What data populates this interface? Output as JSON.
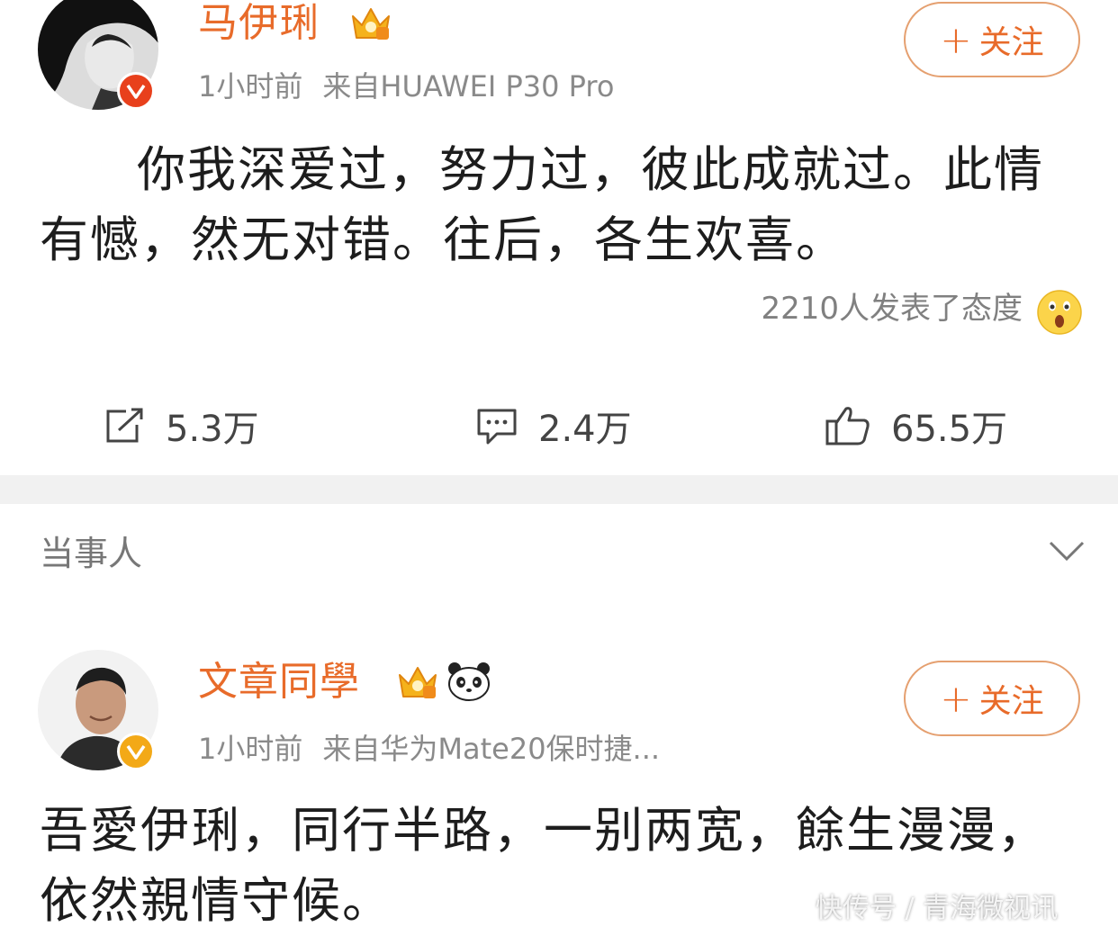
{
  "posts": [
    {
      "username": "马伊琍",
      "time": "1小时前",
      "source": "来自HUAWEI P30 Pro",
      "follow_label": "关注",
      "follow_plus": "+",
      "text": "你我深爱过，努力过，彼此成就过。此情有憾，然无对错。往后，各生欢喜。",
      "attitude": "2210人发表了态度",
      "actions": {
        "repost": "5.3万",
        "comment": "2.4万",
        "like": "65.5万"
      },
      "badge_color": "#e8401c"
    },
    {
      "username": "文章同學",
      "time": "1小时前",
      "source": "来自华为Mate20保时捷...",
      "follow_label": "关注",
      "follow_plus": "+",
      "text": "吾愛伊琍，同行半路，一别两宽，餘生漫漫，依然親情守候。",
      "badge_color": "#f3a917"
    }
  ],
  "section_label": "当事人",
  "watermark": "快传号 / 青海微视讯",
  "colors": {
    "username": "#e86b2a",
    "divider": "#f1f1f1",
    "meta": "#8a8a8a"
  }
}
